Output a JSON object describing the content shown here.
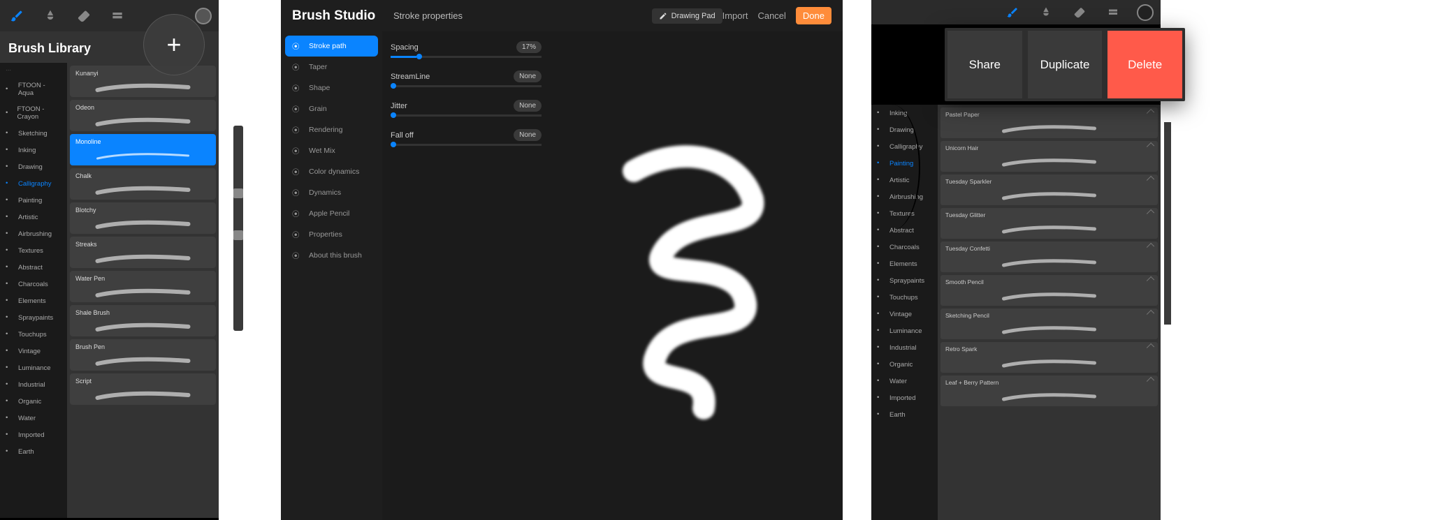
{
  "panel1": {
    "title": "Brush Library",
    "categories": [
      {
        "label": "FTOON - Aqua"
      },
      {
        "label": "FTOON - Crayon"
      },
      {
        "label": "Sketching"
      },
      {
        "label": "Inking"
      },
      {
        "label": "Drawing"
      },
      {
        "label": "Calligraphy",
        "active": true
      },
      {
        "label": "Painting"
      },
      {
        "label": "Artistic"
      },
      {
        "label": "Airbrushing"
      },
      {
        "label": "Textures"
      },
      {
        "label": "Abstract"
      },
      {
        "label": "Charcoals"
      },
      {
        "label": "Elements"
      },
      {
        "label": "Spraypaints"
      },
      {
        "label": "Touchups"
      },
      {
        "label": "Vintage"
      },
      {
        "label": "Luminance"
      },
      {
        "label": "Industrial"
      },
      {
        "label": "Organic"
      },
      {
        "label": "Water"
      },
      {
        "label": "Imported"
      },
      {
        "label": "Earth"
      }
    ],
    "brushes": [
      {
        "name": "Kunanyi"
      },
      {
        "name": "Odeon"
      },
      {
        "name": "Monoline",
        "selected": true
      },
      {
        "name": "Chalk"
      },
      {
        "name": "Blotchy"
      },
      {
        "name": "Streaks"
      },
      {
        "name": "Water Pen"
      },
      {
        "name": "Shale Brush"
      },
      {
        "name": "Brush Pen"
      },
      {
        "name": "Script"
      }
    ],
    "add_label": "+"
  },
  "panel2": {
    "title": "Brush Studio",
    "subtitle": "Stroke properties",
    "drawing_pad": "Drawing Pad",
    "import": "Import",
    "cancel": "Cancel",
    "done": "Done",
    "sidebar": [
      {
        "label": "Stroke path",
        "active": true
      },
      {
        "label": "Taper"
      },
      {
        "label": "Shape"
      },
      {
        "label": "Grain"
      },
      {
        "label": "Rendering"
      },
      {
        "label": "Wet Mix"
      },
      {
        "label": "Color dynamics"
      },
      {
        "label": "Dynamics"
      },
      {
        "label": "Apple Pencil"
      },
      {
        "label": "Properties"
      },
      {
        "label": "About this brush"
      }
    ],
    "props": [
      {
        "name": "Spacing",
        "value": "17%",
        "fill": 17
      },
      {
        "name": "StreamLine",
        "value": "None",
        "fill": 0
      },
      {
        "name": "Jitter",
        "value": "None",
        "fill": 0
      },
      {
        "name": "Fall off",
        "value": "None",
        "fill": 0
      }
    ]
  },
  "panel3": {
    "context": {
      "share": "Share",
      "duplicate": "Duplicate",
      "delete": "Delete"
    },
    "categories": [
      {
        "label": "Inking"
      },
      {
        "label": "Drawing"
      },
      {
        "label": "Calligraphy"
      },
      {
        "label": "Painting"
      },
      {
        "label": "Artistic"
      },
      {
        "label": "Airbrushing"
      },
      {
        "label": "Textures"
      },
      {
        "label": "Abstract"
      },
      {
        "label": "Charcoals"
      },
      {
        "label": "Elements"
      },
      {
        "label": "Spraypaints"
      },
      {
        "label": "Touchups"
      },
      {
        "label": "Vintage"
      },
      {
        "label": "Luminance"
      },
      {
        "label": "Industrial"
      },
      {
        "label": "Organic"
      },
      {
        "label": "Water"
      },
      {
        "label": "Imported"
      },
      {
        "label": "Earth"
      }
    ],
    "brushes": [
      {
        "name": "Pastel Paper"
      },
      {
        "name": "Unicorn Hair"
      },
      {
        "name": "Tuesday Sparkler"
      },
      {
        "name": "Tuesday Glitter"
      },
      {
        "name": "Tuesday Confetti"
      },
      {
        "name": "Smooth Pencil"
      },
      {
        "name": "Sketching Pencil"
      },
      {
        "name": "Retro Spark"
      },
      {
        "name": "Leaf + Berry Pattern"
      }
    ]
  }
}
